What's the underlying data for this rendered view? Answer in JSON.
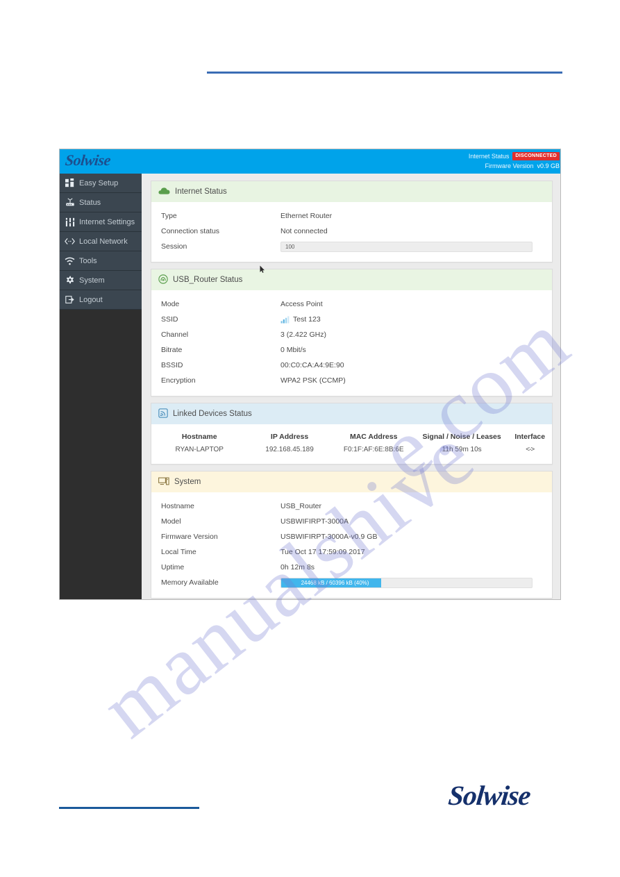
{
  "window": {
    "brand": "Solwise",
    "header": {
      "internet_status_label": "Internet Status",
      "status_badge": "DISCONNECTED",
      "firmware_label": "Firmware Version",
      "firmware_value": "v0.9 GB"
    }
  },
  "sidebar": {
    "items": [
      {
        "label": "Easy Setup",
        "icon": "grid-icon"
      },
      {
        "label": "Status",
        "icon": "router-icon"
      },
      {
        "label": "Internet Settings",
        "icon": "sliders-icon"
      },
      {
        "label": "Local Network",
        "icon": "arrows-icon"
      },
      {
        "label": "Tools",
        "icon": "wifi-icon"
      },
      {
        "label": "System",
        "icon": "gear-icon"
      },
      {
        "label": "Logout",
        "icon": "logout-icon"
      }
    ]
  },
  "sections": {
    "internet": {
      "title": "Internet Status",
      "icon": "cloud-icon",
      "rows": [
        {
          "key": "Type",
          "value": "Ethernet Router"
        },
        {
          "key": "Connection status",
          "value": "Not connected"
        }
      ],
      "session": {
        "key": "Session",
        "value": "100",
        "percent": 0
      }
    },
    "usb_router": {
      "title": "USB_Router Status",
      "icon": "signal-radio-icon",
      "rows": [
        {
          "key": "Mode",
          "value": "Access Point"
        },
        {
          "key": "SSID",
          "value": "Test 123"
        },
        {
          "key": "Channel",
          "value": "3 (2.422 GHz)"
        },
        {
          "key": "Bitrate",
          "value": "0 Mbit/s"
        },
        {
          "key": "BSSID",
          "value": "00:C0:CA:A4:9E:90"
        },
        {
          "key": "Encryption",
          "value": "WPA2 PSK (CCMP)"
        }
      ]
    },
    "linked_devices": {
      "title": "Linked Devices Status",
      "icon": "broadcast-icon",
      "columns": [
        "Hostname",
        "IP Address",
        "MAC Address",
        "Signal / Noise / Leases",
        "Interface"
      ],
      "rows": [
        {
          "hostname": "RYAN-LAPTOP",
          "ip": "192.168.45.189",
          "mac": "F0:1F:AF:6E:8B:6E",
          "signal": "11h 59m 10s",
          "interface": "<->"
        }
      ]
    },
    "system": {
      "title": "System",
      "icon": "monitor-icon",
      "rows": [
        {
          "key": "Hostname",
          "value": "USB_Router"
        },
        {
          "key": "Model",
          "value": "USBWIFIRPT-3000A"
        },
        {
          "key": "Firmware Version",
          "value": "USBWIFIRPT-3000A-v0.9 GB"
        },
        {
          "key": "Local Time",
          "value": "Tue Oct 17 17:59:09 2017"
        },
        {
          "key": "Uptime",
          "value": "0h 12m 8s"
        }
      ],
      "memory": {
        "key": "Memory Available",
        "value": "24468 kB / 60396 kB (40%)",
        "percent": 40
      }
    }
  },
  "footer": {
    "logo": "Solwise"
  },
  "watermark": {
    "text_a": "manualshive",
    "text_b": "e.com"
  },
  "colors": {
    "topbar": "#00a3ea",
    "badge": "#e2302f",
    "accent_blue": "#41b6ec",
    "sidebar": "#2e2e2e",
    "nav_item": "#3b4650"
  }
}
